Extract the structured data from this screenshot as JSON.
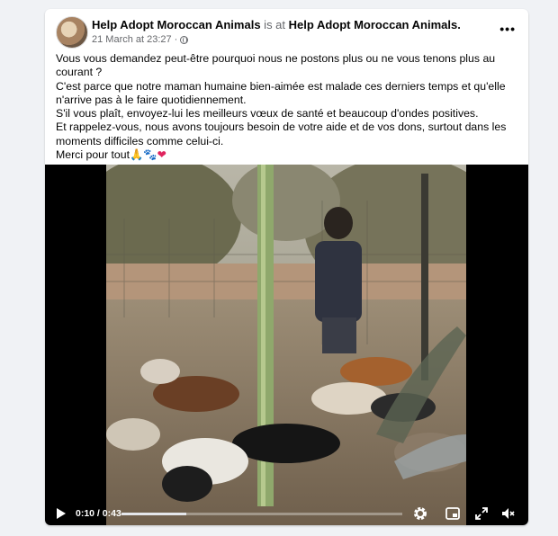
{
  "post": {
    "page_name": "Help Adopt Moroccan Animals",
    "is_at_text": " is at ",
    "location_name": "Help Adopt Moroccan Animals.",
    "timestamp": "21 March at 23:27",
    "separator": " · ",
    "more_label": "•••",
    "paragraphs": [
      "Vous vous demandez peut-être pourquoi nous ne postons plus ou ne vous tenons plus au courant ?",
      "C'est parce que notre maman humaine bien-aimée est malade ces derniers temps et qu'elle n'arrive pas à le faire quotidiennement.",
      "S'il vous plaît, envoyez-lui les meilleurs vœux de santé et beaucoup d'ondes positives.",
      "Et rappelez-vous, nous avons toujours besoin de votre aide et de vos dons, surtout dans les moments difficiles comme celui-ci."
    ],
    "closing_text": "Merci pour tout",
    "closing_emoji": [
      "🙏",
      "🐾",
      "❤"
    ]
  },
  "video": {
    "current_time": "0:10",
    "duration": "0:43",
    "time_separator": " / ",
    "progress_fraction": 0.23,
    "icons": [
      "play-icon",
      "settings-icon",
      "picture-in-picture-icon",
      "fullscreen-icon",
      "volume-muted-icon"
    ]
  }
}
